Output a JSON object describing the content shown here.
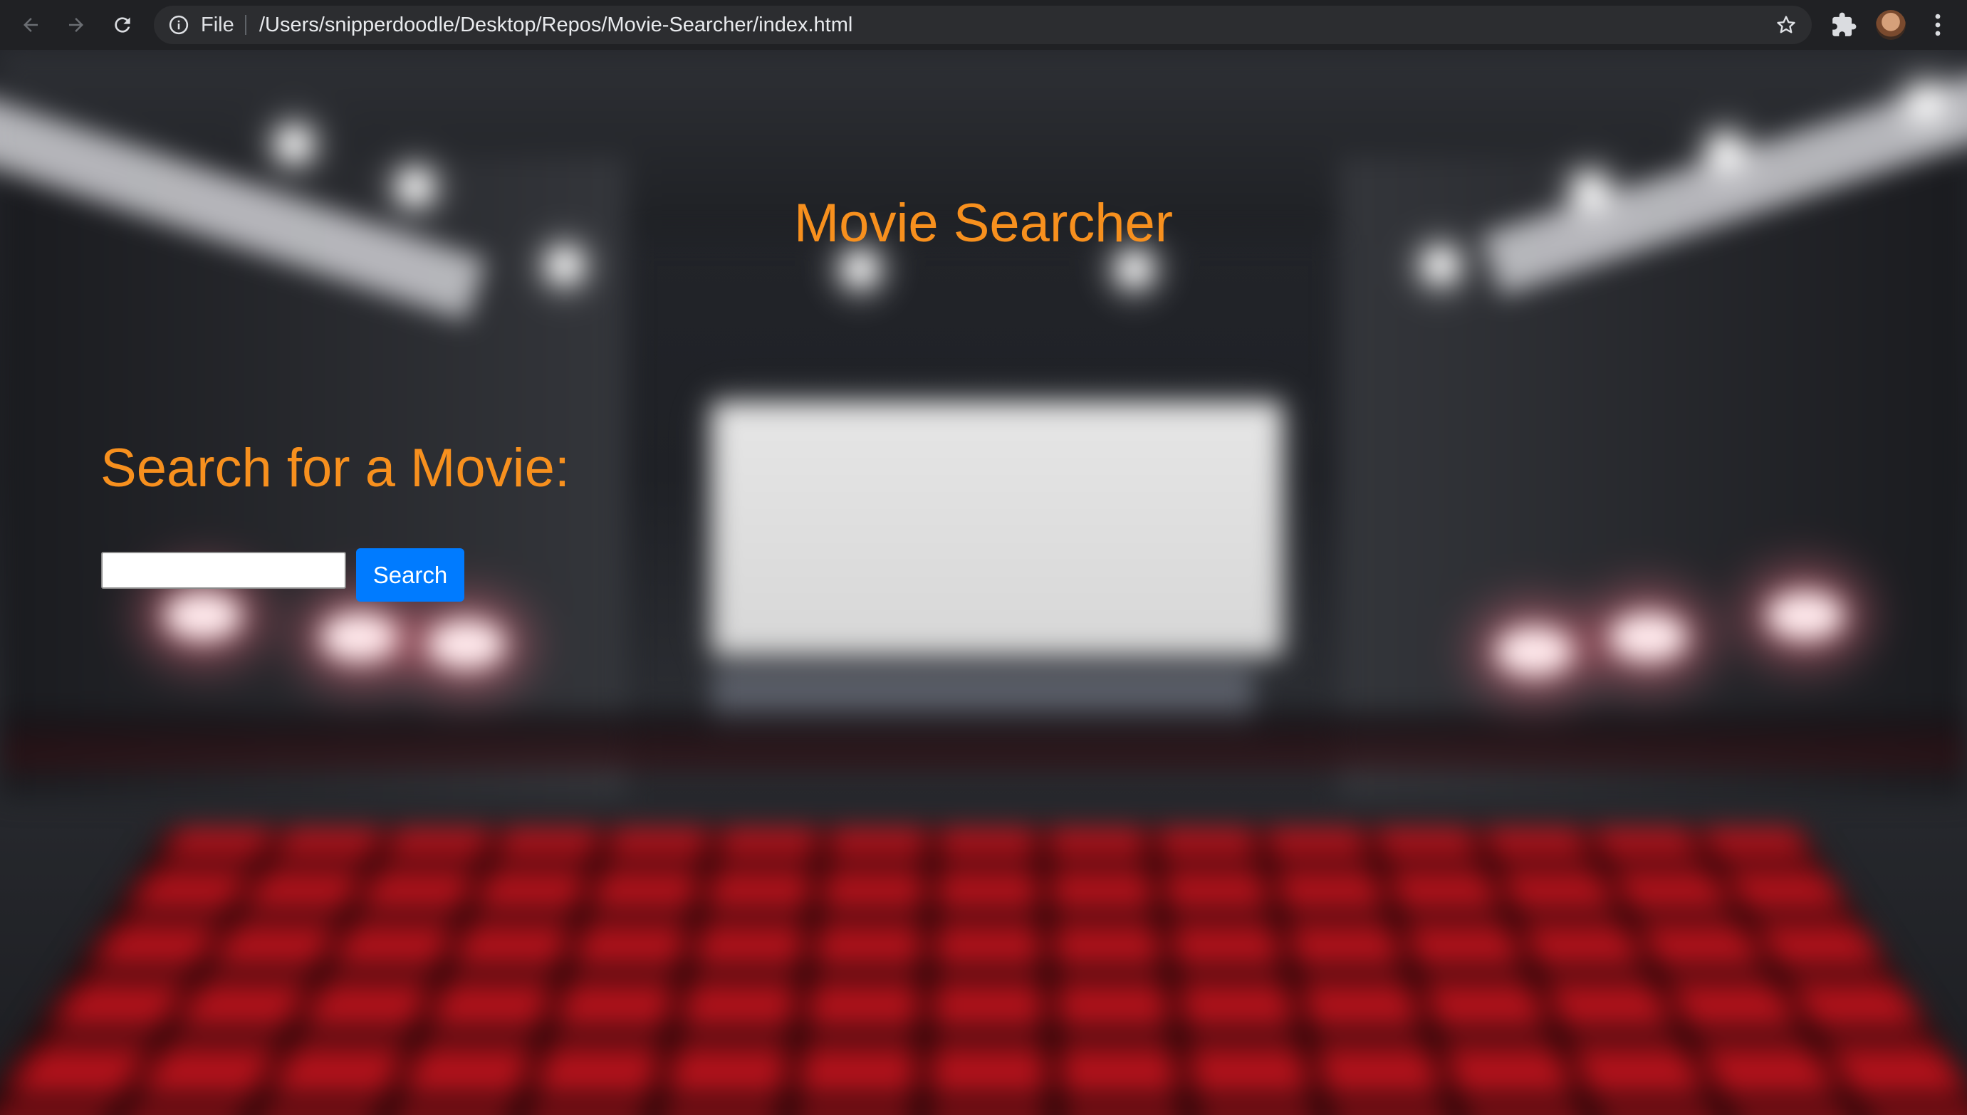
{
  "browser": {
    "address_scheme": "File",
    "address_url": "/Users/snipperdoodle/Desktop/Repos/Movie-Searcher/index.html",
    "icons": {
      "back": "arrow-left-icon",
      "forward": "arrow-right-icon",
      "reload": "reload-icon",
      "site_info": "info-icon",
      "bookmark": "star-icon",
      "extensions": "puzzle-icon",
      "profile": "avatar",
      "menu": "kebab-menu-icon"
    }
  },
  "page": {
    "title": "Movie Searcher",
    "search_heading": "Search for a Movie:",
    "search_input_value": "",
    "search_button_label": "Search"
  },
  "colors": {
    "accent_orange": "#f7901e",
    "button_blue": "#007bff",
    "chrome_bg": "#202124",
    "omnibox_bg": "#2c2d30"
  }
}
